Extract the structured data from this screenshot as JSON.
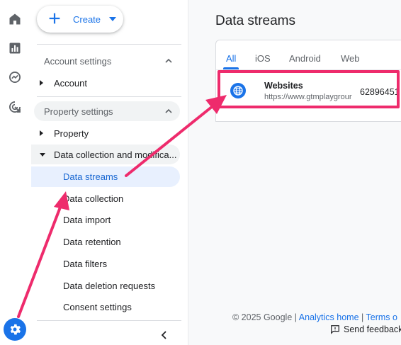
{
  "colors": {
    "accent": "#1a73e8",
    "annotation": "#ee2b6c",
    "selected_bg": "#e8f0fe"
  },
  "rail": {
    "icons": [
      "home-icon",
      "reports-icon",
      "explore-icon",
      "advertising-icon"
    ],
    "settings_icon": "gear-icon"
  },
  "nav": {
    "create_label": "Create",
    "account_settings": {
      "title": "Account settings",
      "items": [
        {
          "label": "Account"
        }
      ]
    },
    "property_settings": {
      "title": "Property settings",
      "items": [
        {
          "label": "Property"
        },
        {
          "label": "Data collection and modifica..."
        }
      ],
      "subitems": [
        {
          "label": "Data streams",
          "selected": true
        },
        {
          "label": "Data collection"
        },
        {
          "label": "Data import"
        },
        {
          "label": "Data retention"
        },
        {
          "label": "Data filters"
        },
        {
          "label": "Data deletion requests"
        },
        {
          "label": "Consent settings"
        }
      ]
    }
  },
  "main": {
    "title": "Data streams",
    "tabs": [
      {
        "label": "All",
        "active": true
      },
      {
        "label": "iOS"
      },
      {
        "label": "Android"
      },
      {
        "label": "Web"
      }
    ],
    "streams": [
      {
        "name": "Websites",
        "url": "https://www.gtmplaygrour",
        "id": "62896451"
      }
    ],
    "footer": {
      "copyright": "© 2025 Google | ",
      "analytics_home": "Analytics home",
      "separator": " | ",
      "terms": "Terms o",
      "send_feedback": "Send feedback"
    }
  }
}
